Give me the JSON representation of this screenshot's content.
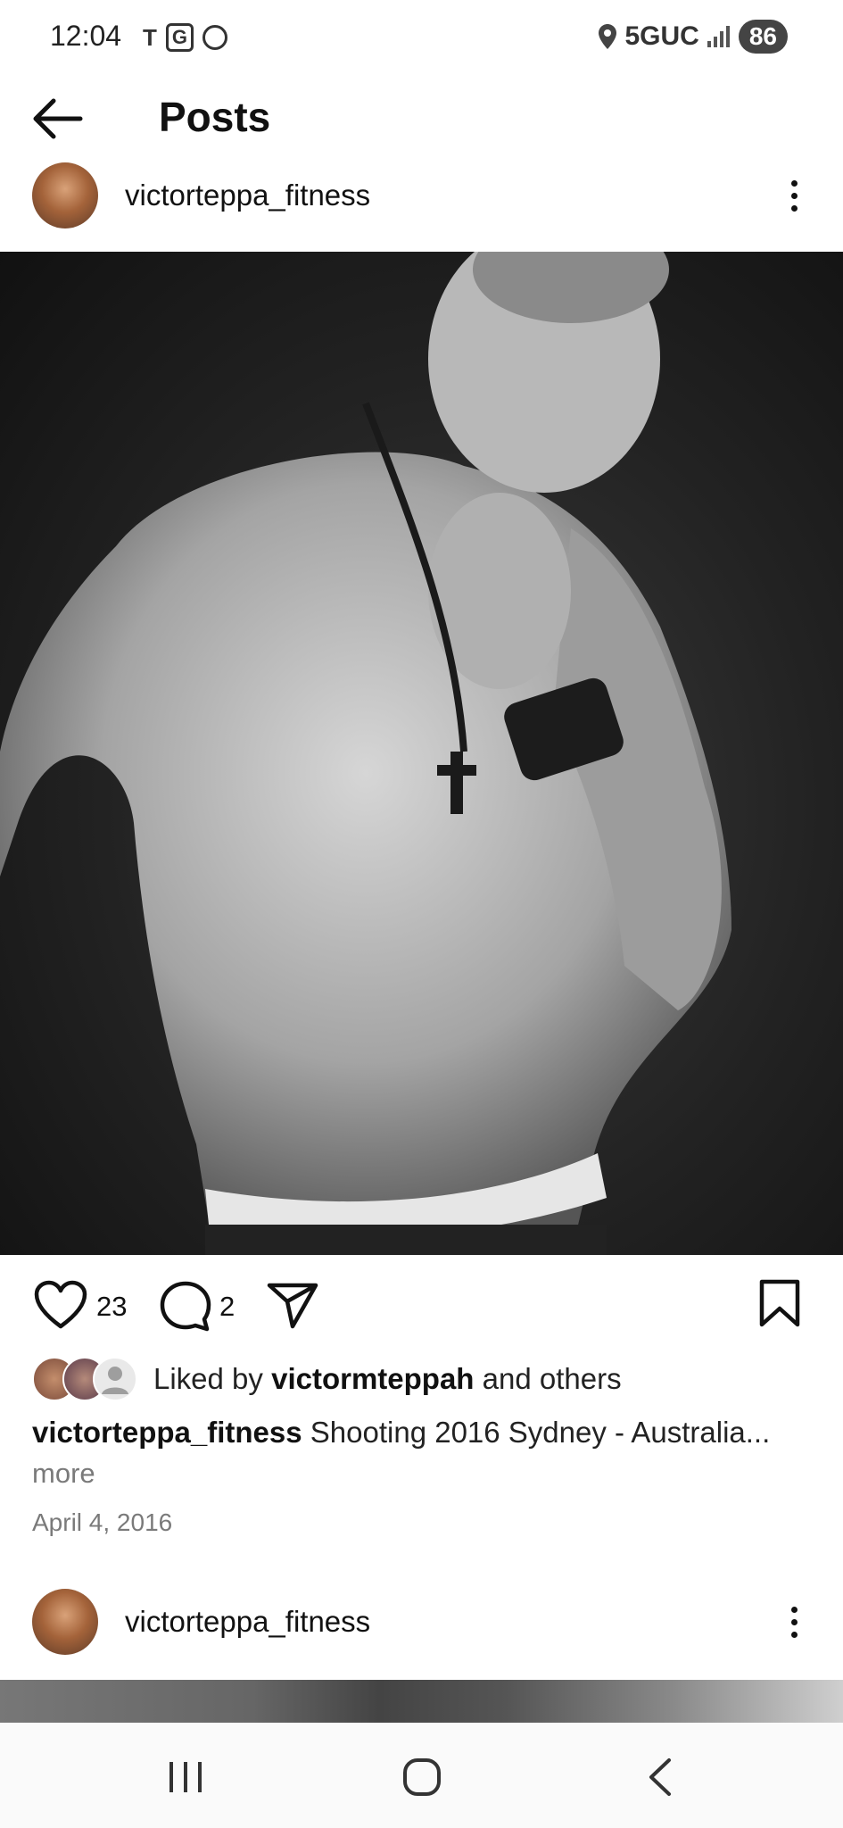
{
  "status_bar": {
    "time": "12:04",
    "carrier_icons": [
      "T",
      "G",
      "mobile-data-icon"
    ],
    "network": "5GUC",
    "battery": "86"
  },
  "header": {
    "title": "Posts"
  },
  "post1": {
    "username": "victorteppa_fitness",
    "likes_count": "23",
    "comments_count": "2",
    "liked_by_prefix": "Liked by",
    "liked_by_user": "victormteppah",
    "liked_by_suffix": "and others",
    "caption_user": "victorteppa_fitness",
    "caption_text": "Shooting 2016 Sydney - Australia...",
    "more_label": "more",
    "date": "April 4, 2016"
  },
  "post2": {
    "username": "victorteppa_fitness"
  },
  "colors": {
    "text": "#111111",
    "muted": "#7a7a7a",
    "background": "#ffffff"
  }
}
